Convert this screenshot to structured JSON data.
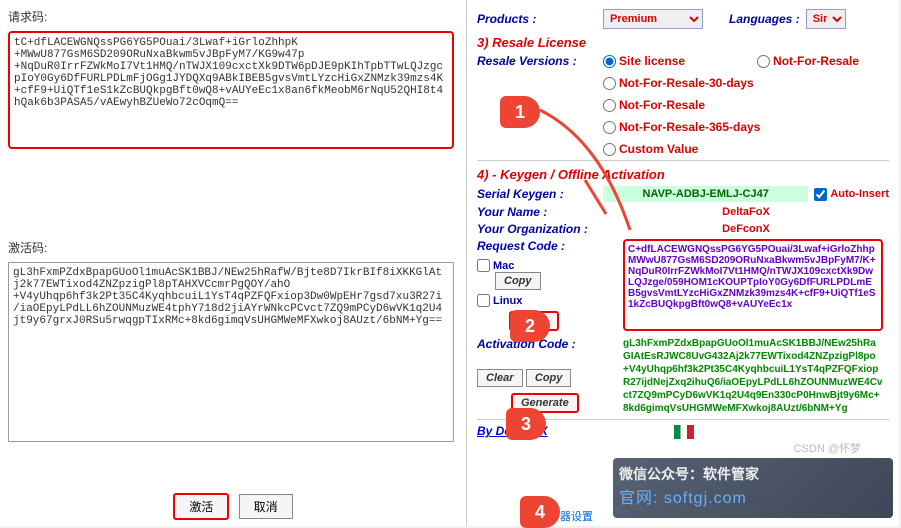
{
  "left": {
    "request_label": "请求码:",
    "request_code": "tC+dfLACEWGNQssPG6YG5POuai/3Lwaf+iGrloZhhpK\n+MWwU877GsM6SD209ORuNxaBkwm5vJBpFyM7/KG9w47p\n+NqDuR0IrrFZWkMoI7Vt1HMQ/nTWJX109cxctXk9DTW6pDJE9pKIhTpbTTwLQJzgc\npIoY0Gy6DfFURLPDLmFjOGg1JYDQXq9ABkIBEB5gvsVmtLYzcHiGxZNMzk39mzs4K\n+cfF9+UiQTf1eS1kZcBUQkpgBft0wQ8+vAUYeEc1x8an6fkMeobM6rNqU52QHI8t4\nhQak6b3PASA5/vAEwyhBZUeWo72cOqmQ==",
    "activation_label": "激活码:",
    "activation_code": "gL3hFxmPZdxBpapGUoOl1muAcSK1BBJ/NEw25hRafW/Bjte8D7IkrBIf8iXKKGlAt\nj2k77EWTixod4ZNZpzigPl8pTAHXVCcmrPgQOY/ahO\n+V4yUhqp6hf3k2Pt35C4KyqhbcuiL1YsT4qPZFQFxiop3Dw0WpEHr7gsd7xu3R27i\n/iaOEpyLPdLL6hZOUNMuzWE4tphY718d2jiAYrWNkcPCvct7ZQ9mPCyD6wVK1q2U4\njt9y67grxJ0RSu5rwqgpTIxRMc+8kd6gimqVsUHGMWeMFXwkoj8AUzt/6bNM+Yg==",
    "activate_btn": "激活",
    "cancel_btn": "取消"
  },
  "right": {
    "products_label": "Products :",
    "products_value": "Premium",
    "languages_label": "Languages :",
    "languages_value": "Sim",
    "section3": "3) Resale License",
    "resale_versions_label": "Resale Versions :",
    "resale_options": {
      "site": "Site license",
      "nfr30": "Not-For-Resale-30-days",
      "nfr365": "Not-For-Resale-365-days",
      "nfr": "Not-For-Resale",
      "nfr2": "Not-For-Resale",
      "custom": "Custom Value"
    },
    "section4": "4) - Keygen / Offline Activation",
    "serial_label": "Serial Keygen :",
    "serial_value": "NAVP-ADBJ-EMLJ-CJ47",
    "auto_insert": "Auto-Insert",
    "your_name_label": "Your Name :",
    "your_name_value": "DeltaFoX",
    "your_org_label": "Your Organization :",
    "your_org_value": "DeFconX",
    "request_code_label": "Request Code :",
    "request_code_value": "C+dfLACEWGNQssPG6YG5POuai/3Lwaf+iGrloZhhpMWwU877GsM6SD209ORuNxaBkwm5vJBpFyM7/K+NqDuR0IrrFZWkMoI7Vt1HMQ/nTWJX109cxctXk9DwLQJzge/059HOM1cKOUPTpIoY0Gy6DfFURLPDLmEB5gvsVmtLYzcHiGxZNMzk39mzs4K+cfF9+UiQTf1eS1kZcBUQkpgBft0wQ8+vAUYeEc1x",
    "mac_label": "Mac",
    "linux_label": "Linux",
    "copy_btn": "Copy",
    "paste_btn": "Paste",
    "clear_btn": "Clear",
    "generate_btn": "Generate",
    "activation_code_label": "Activation Code :",
    "activation_code_value": "gL3hFxmPZdxBpapGUoOl1muAcSK1BBJ/NEw25hRaGIAtEsRJWC8UvG432Aj2k77EWTixod4ZNZpzigPl8po\n+V4yUhqp6hf3k2Pt35C4KyqhbcuiL1YsT4qPZFQFxiopR27ijdNejZxq2ihuQ6/iaOEpyLPdLL6hZOUNMuzWE4Cvct7ZQ9mPCyD6wVK1q2U4q9En330cP0HnwBjt9y6Mc+8kd6gimqVsUHGMWeMFXwkoj8AUzt/6bNM+Yg",
    "by_label": "By DeltaFoX",
    "footer_link": "器设置"
  },
  "watermark": {
    "line1": "微信公众号：软件管家",
    "line2": "官网: softgj.com"
  },
  "csdn": "CSDN @怀梦",
  "steps": {
    "s1": "1",
    "s2": "2",
    "s3": "3",
    "s4": "4"
  }
}
